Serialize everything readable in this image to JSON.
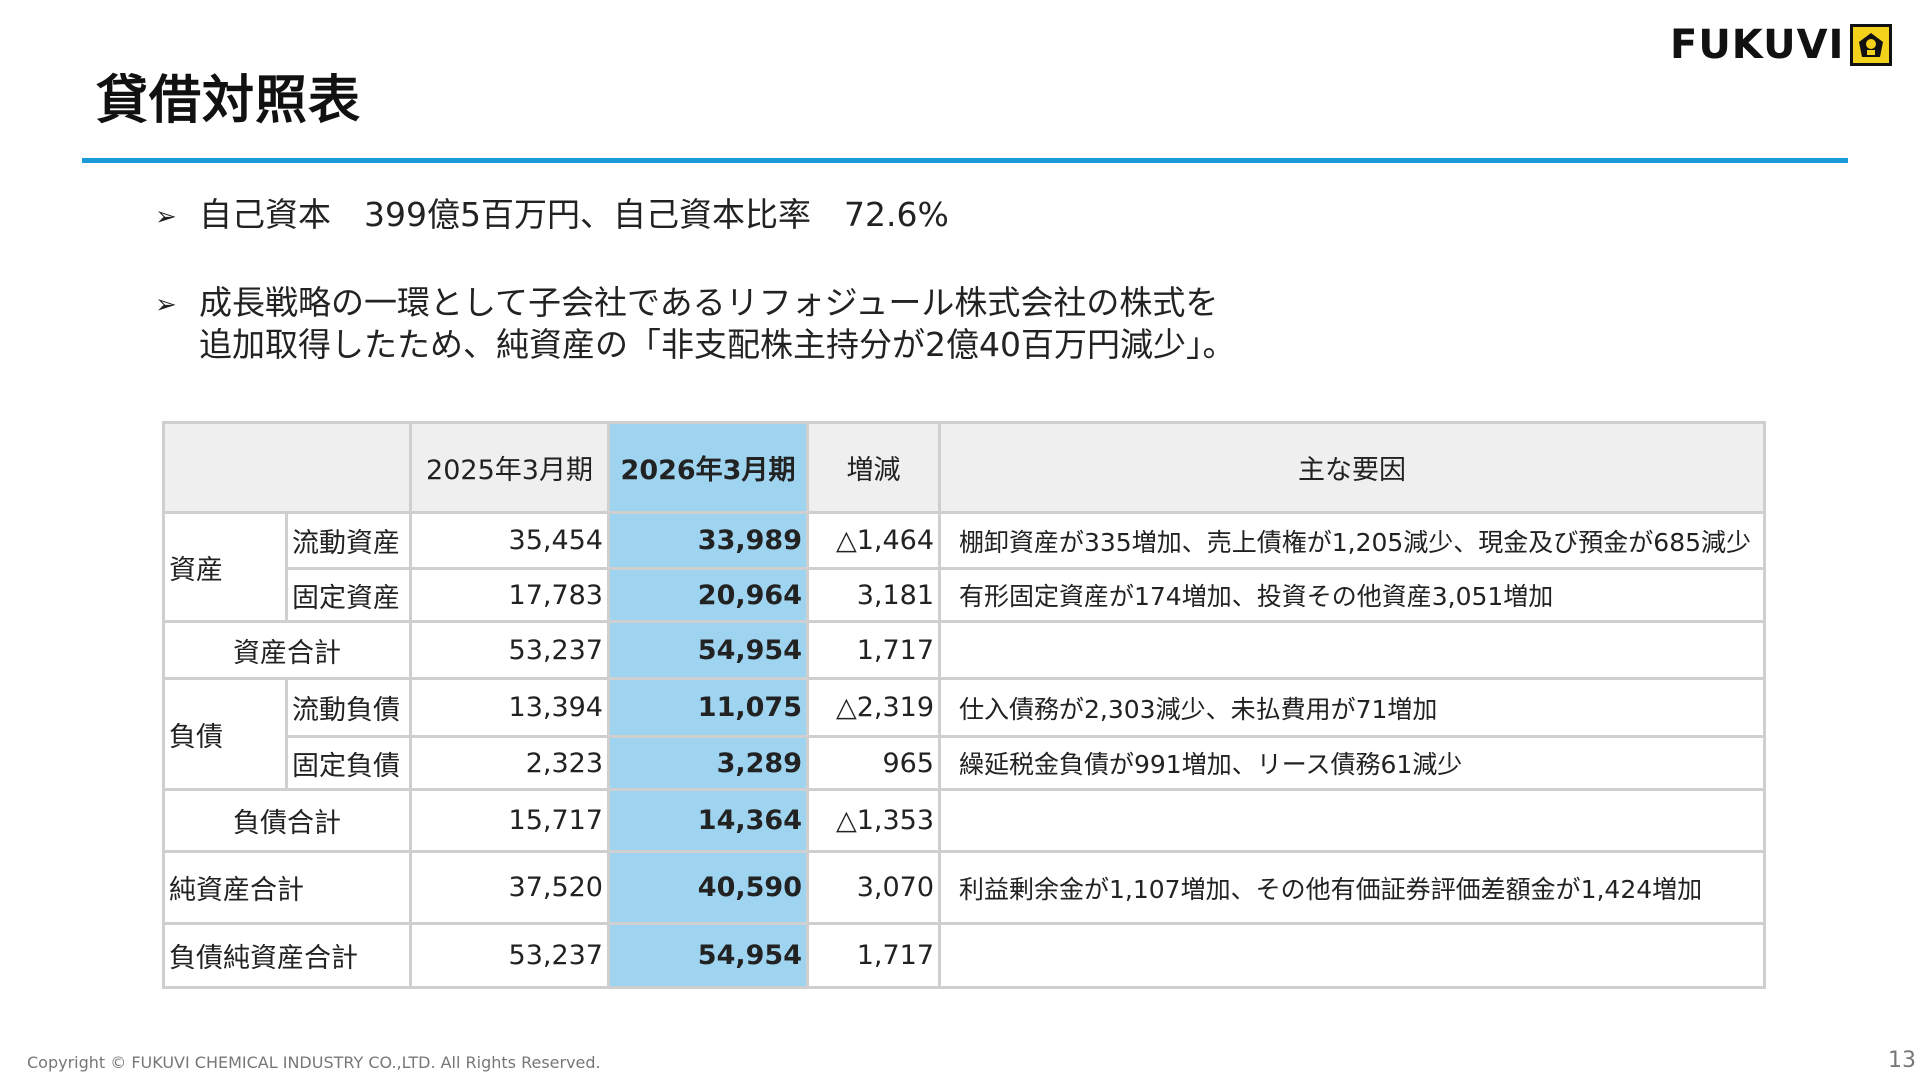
{
  "slide": {
    "title": "貸借対照表",
    "logo_text": "FUKUVI",
    "bullets": [
      {
        "line1": "自己資本　399億5百万円、自己資本比率　72.6%"
      },
      {
        "line1": "成長戦略の一環として子会社であるリフォジュール株式会社の株式を",
        "line2": "追加取得したため、純資産の「非支配株主持分が2億40百万円減少」。"
      }
    ],
    "footer": "Copyright © FUKUVI CHEMICAL INDUSTRY CO.,LTD. All Rights Reserved.",
    "page_number": "13"
  },
  "table": {
    "headers": {
      "prev": "2025年3月期",
      "curr": "2026年3月期",
      "diff": "増減",
      "reason": "主な要因"
    },
    "assets": {
      "group": "資産",
      "rows": [
        {
          "label": "流動資産",
          "prev": "35,454",
          "curr": "33,989",
          "diff": "△1,464",
          "reason": "棚卸資産が335増加、売上債権が1,205減少、現金及び預金が685減少"
        },
        {
          "label": "固定資産",
          "prev": "17,783",
          "curr": "20,964",
          "diff": "3,181",
          "reason": "有形固定資産が174増加、投資その他資産3,051増加"
        }
      ],
      "total": {
        "label": "資産合計",
        "prev": "53,237",
        "curr": "54,954",
        "diff": "1,717",
        "reason": ""
      }
    },
    "liabilities": {
      "group": "負債",
      "rows": [
        {
          "label": "流動負債",
          "prev": "13,394",
          "curr": "11,075",
          "diff": "△2,319",
          "reason": "仕入債務が2,303減少、未払費用が71増加"
        },
        {
          "label": "固定負債",
          "prev": "2,323",
          "curr": "3,289",
          "diff": "965",
          "reason": "繰延税金負債が991増加、リース債務61減少"
        }
      ],
      "total": {
        "label": "負債合計",
        "prev": "15,717",
        "curr": "14,364",
        "diff": "△1,353",
        "reason": ""
      }
    },
    "net_assets": {
      "label": "純資産合計",
      "prev": "37,520",
      "curr": "40,590",
      "diff": "3,070",
      "reason": "利益剰余金が1,107増加、その他有価証券評価差額金が1,424増加"
    },
    "grand_total": {
      "label": "負債純資産合計",
      "prev": "53,237",
      "curr": "54,954",
      "diff": "1,717",
      "reason": ""
    }
  }
}
